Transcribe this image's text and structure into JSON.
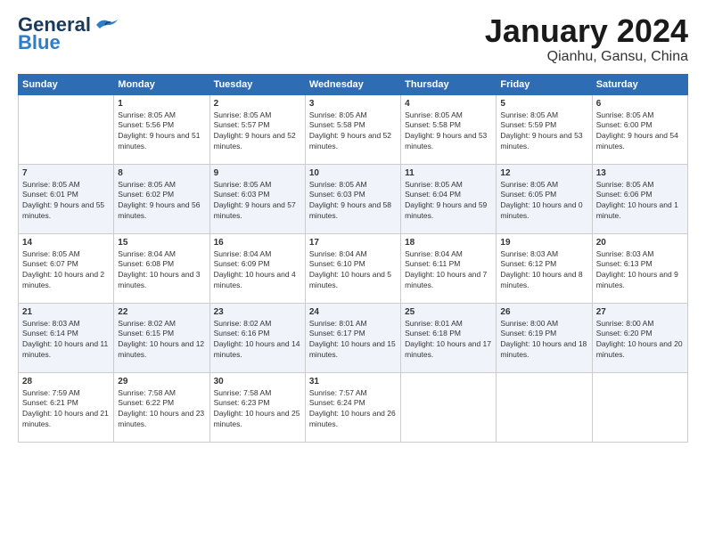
{
  "header": {
    "logo": {
      "general": "General",
      "blue": "Blue"
    },
    "title": "January 2024",
    "subtitle": "Qianhu, Gansu, China"
  },
  "days_of_week": [
    "Sunday",
    "Monday",
    "Tuesday",
    "Wednesday",
    "Thursday",
    "Friday",
    "Saturday"
  ],
  "weeks": [
    [
      null,
      {
        "day": "1",
        "sunrise": "Sunrise: 8:05 AM",
        "sunset": "Sunset: 5:56 PM",
        "daylight": "Daylight: 9 hours and 51 minutes."
      },
      {
        "day": "2",
        "sunrise": "Sunrise: 8:05 AM",
        "sunset": "Sunset: 5:57 PM",
        "daylight": "Daylight: 9 hours and 52 minutes."
      },
      {
        "day": "3",
        "sunrise": "Sunrise: 8:05 AM",
        "sunset": "Sunset: 5:58 PM",
        "daylight": "Daylight: 9 hours and 52 minutes."
      },
      {
        "day": "4",
        "sunrise": "Sunrise: 8:05 AM",
        "sunset": "Sunset: 5:58 PM",
        "daylight": "Daylight: 9 hours and 53 minutes."
      },
      {
        "day": "5",
        "sunrise": "Sunrise: 8:05 AM",
        "sunset": "Sunset: 5:59 PM",
        "daylight": "Daylight: 9 hours and 53 minutes."
      },
      {
        "day": "6",
        "sunrise": "Sunrise: 8:05 AM",
        "sunset": "Sunset: 6:00 PM",
        "daylight": "Daylight: 9 hours and 54 minutes."
      }
    ],
    [
      {
        "day": "7",
        "sunrise": "Sunrise: 8:05 AM",
        "sunset": "Sunset: 6:01 PM",
        "daylight": "Daylight: 9 hours and 55 minutes."
      },
      {
        "day": "8",
        "sunrise": "Sunrise: 8:05 AM",
        "sunset": "Sunset: 6:02 PM",
        "daylight": "Daylight: 9 hours and 56 minutes."
      },
      {
        "day": "9",
        "sunrise": "Sunrise: 8:05 AM",
        "sunset": "Sunset: 6:03 PM",
        "daylight": "Daylight: 9 hours and 57 minutes."
      },
      {
        "day": "10",
        "sunrise": "Sunrise: 8:05 AM",
        "sunset": "Sunset: 6:03 PM",
        "daylight": "Daylight: 9 hours and 58 minutes."
      },
      {
        "day": "11",
        "sunrise": "Sunrise: 8:05 AM",
        "sunset": "Sunset: 6:04 PM",
        "daylight": "Daylight: 9 hours and 59 minutes."
      },
      {
        "day": "12",
        "sunrise": "Sunrise: 8:05 AM",
        "sunset": "Sunset: 6:05 PM",
        "daylight": "Daylight: 10 hours and 0 minutes."
      },
      {
        "day": "13",
        "sunrise": "Sunrise: 8:05 AM",
        "sunset": "Sunset: 6:06 PM",
        "daylight": "Daylight: 10 hours and 1 minute."
      }
    ],
    [
      {
        "day": "14",
        "sunrise": "Sunrise: 8:05 AM",
        "sunset": "Sunset: 6:07 PM",
        "daylight": "Daylight: 10 hours and 2 minutes."
      },
      {
        "day": "15",
        "sunrise": "Sunrise: 8:04 AM",
        "sunset": "Sunset: 6:08 PM",
        "daylight": "Daylight: 10 hours and 3 minutes."
      },
      {
        "day": "16",
        "sunrise": "Sunrise: 8:04 AM",
        "sunset": "Sunset: 6:09 PM",
        "daylight": "Daylight: 10 hours and 4 minutes."
      },
      {
        "day": "17",
        "sunrise": "Sunrise: 8:04 AM",
        "sunset": "Sunset: 6:10 PM",
        "daylight": "Daylight: 10 hours and 5 minutes."
      },
      {
        "day": "18",
        "sunrise": "Sunrise: 8:04 AM",
        "sunset": "Sunset: 6:11 PM",
        "daylight": "Daylight: 10 hours and 7 minutes."
      },
      {
        "day": "19",
        "sunrise": "Sunrise: 8:03 AM",
        "sunset": "Sunset: 6:12 PM",
        "daylight": "Daylight: 10 hours and 8 minutes."
      },
      {
        "day": "20",
        "sunrise": "Sunrise: 8:03 AM",
        "sunset": "Sunset: 6:13 PM",
        "daylight": "Daylight: 10 hours and 9 minutes."
      }
    ],
    [
      {
        "day": "21",
        "sunrise": "Sunrise: 8:03 AM",
        "sunset": "Sunset: 6:14 PM",
        "daylight": "Daylight: 10 hours and 11 minutes."
      },
      {
        "day": "22",
        "sunrise": "Sunrise: 8:02 AM",
        "sunset": "Sunset: 6:15 PM",
        "daylight": "Daylight: 10 hours and 12 minutes."
      },
      {
        "day": "23",
        "sunrise": "Sunrise: 8:02 AM",
        "sunset": "Sunset: 6:16 PM",
        "daylight": "Daylight: 10 hours and 14 minutes."
      },
      {
        "day": "24",
        "sunrise": "Sunrise: 8:01 AM",
        "sunset": "Sunset: 6:17 PM",
        "daylight": "Daylight: 10 hours and 15 minutes."
      },
      {
        "day": "25",
        "sunrise": "Sunrise: 8:01 AM",
        "sunset": "Sunset: 6:18 PM",
        "daylight": "Daylight: 10 hours and 17 minutes."
      },
      {
        "day": "26",
        "sunrise": "Sunrise: 8:00 AM",
        "sunset": "Sunset: 6:19 PM",
        "daylight": "Daylight: 10 hours and 18 minutes."
      },
      {
        "day": "27",
        "sunrise": "Sunrise: 8:00 AM",
        "sunset": "Sunset: 6:20 PM",
        "daylight": "Daylight: 10 hours and 20 minutes."
      }
    ],
    [
      {
        "day": "28",
        "sunrise": "Sunrise: 7:59 AM",
        "sunset": "Sunset: 6:21 PM",
        "daylight": "Daylight: 10 hours and 21 minutes."
      },
      {
        "day": "29",
        "sunrise": "Sunrise: 7:58 AM",
        "sunset": "Sunset: 6:22 PM",
        "daylight": "Daylight: 10 hours and 23 minutes."
      },
      {
        "day": "30",
        "sunrise": "Sunrise: 7:58 AM",
        "sunset": "Sunset: 6:23 PM",
        "daylight": "Daylight: 10 hours and 25 minutes."
      },
      {
        "day": "31",
        "sunrise": "Sunrise: 7:57 AM",
        "sunset": "Sunset: 6:24 PM",
        "daylight": "Daylight: 10 hours and 26 minutes."
      },
      null,
      null,
      null
    ]
  ]
}
